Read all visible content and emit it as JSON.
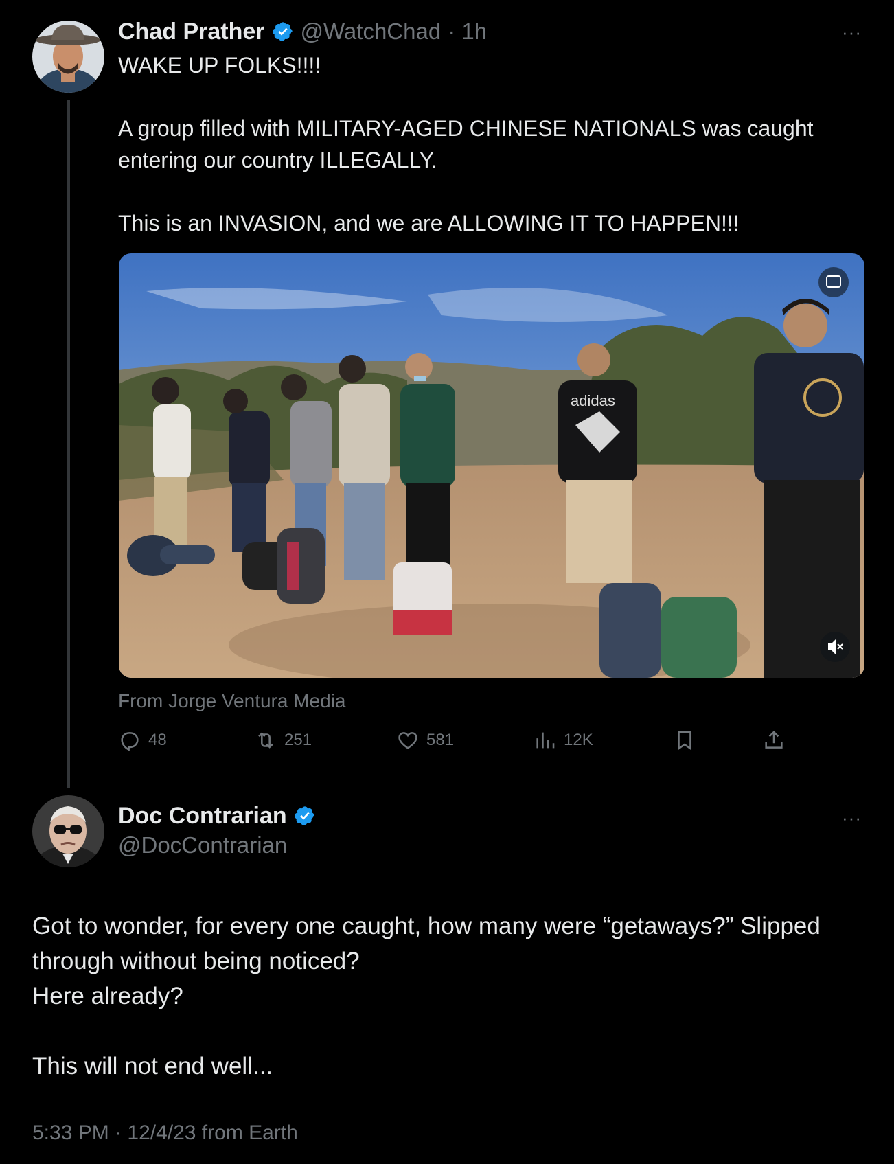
{
  "tweet1": {
    "name": "Chad Prather",
    "handle": "@WatchChad",
    "dot_time": "· 1h",
    "more": "···",
    "text": "WAKE UP FOLKS!!!!\n\nA group filled with MILITARY-AGED CHINESE NATIONALS was caught entering our country ILLEGALLY.\n\nThis is an INVASION, and we are ALLOWING IT TO HAPPEN!!!",
    "media_source": "From Jorge Ventura Media",
    "media_logo_text": "adidas",
    "stats": {
      "replies": "48",
      "reposts": "251",
      "likes": "581",
      "views": "12K"
    },
    "icons": [
      "reply-icon",
      "repost-icon",
      "like-icon",
      "views-icon",
      "bookmark-icon",
      "share-icon"
    ]
  },
  "tweet2": {
    "name": "Doc Contrarian",
    "handle": "@DocContrarian",
    "more": "···",
    "text": "Got to wonder, for every one caught, how many were “getaways?” Slipped through without being noticed?\nHere already?\n\nThis will not end well...",
    "timestamp": "5:33 PM · 12/4/23 from Earth"
  },
  "colors": {
    "background": "#000000",
    "text": "#e7e9ea",
    "muted": "#71767b",
    "verified": "#1d9bf0",
    "thread_line": "#333639"
  }
}
